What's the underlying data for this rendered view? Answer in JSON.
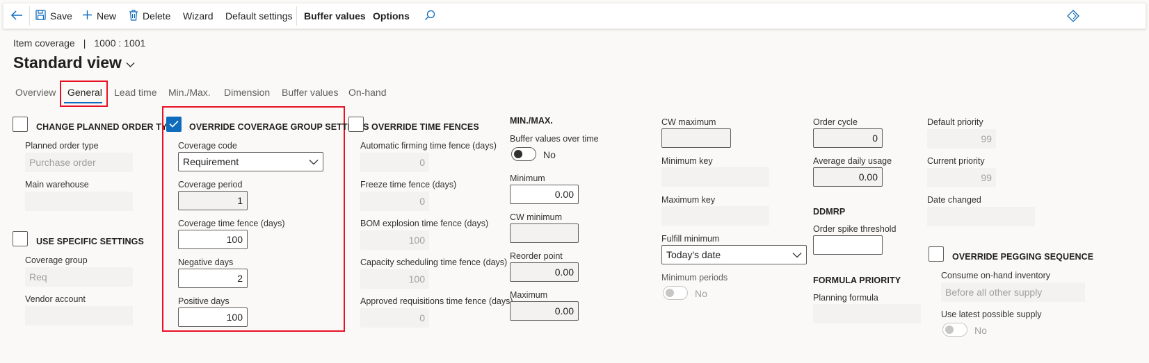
{
  "toolbar": {
    "save": "Save",
    "new": "New",
    "delete": "Delete",
    "wizard": "Wizard",
    "default_settings": "Default settings",
    "buffer_values": "Buffer values",
    "options": "Options",
    "accent": "#0f6cbd"
  },
  "breadcrumb": {
    "page": "Item coverage",
    "separator": "|",
    "record": "1000 : 1001"
  },
  "title": "Standard view",
  "tabs": [
    "Overview",
    "General",
    "Lead time",
    "Min./Max.",
    "Dimension",
    "Buffer values",
    "On-hand"
  ],
  "active_tab": "General",
  "change_planned": {
    "title": "CHANGE PLANNED ORDER TYPE",
    "checked": false,
    "planned_order_type_label": "Planned order type",
    "planned_order_type_value": "Purchase order",
    "main_warehouse_label": "Main warehouse",
    "main_warehouse_value": ""
  },
  "use_specific": {
    "title": "USE SPECIFIC SETTINGS",
    "checked": false,
    "coverage_group_label": "Coverage group",
    "coverage_group_value": "Req",
    "vendor_account_label": "Vendor account",
    "vendor_account_value": ""
  },
  "override_coverage": {
    "title": "OVERRIDE COVERAGE GROUP SETTINGS",
    "checked": true,
    "coverage_code_label": "Coverage code",
    "coverage_code_value": "Requirement",
    "coverage_period_label": "Coverage period",
    "coverage_period_value": "1",
    "coverage_time_fence_label": "Coverage time fence (days)",
    "coverage_time_fence_value": "100",
    "negative_days_label": "Negative days",
    "negative_days_value": "2",
    "positive_days_label": "Positive days",
    "positive_days_value": "100"
  },
  "override_time_fences": {
    "title": "OVERRIDE TIME FENCES",
    "checked": false,
    "auto_firming_label": "Automatic firming time fence (days)",
    "auto_firming_value": "0",
    "freeze_label": "Freeze time fence (days)",
    "freeze_value": "0",
    "bom_label": "BOM explosion time fence (days)",
    "bom_value": "100",
    "capacity_label": "Capacity scheduling time fence (days)",
    "capacity_value": "100",
    "approved_label": "Approved requisitions time fence (days)",
    "approved_value": "0"
  },
  "minmax": {
    "title": "MIN./MAX.",
    "buffer_over_time_label": "Buffer values over time",
    "buffer_over_time_state": "No",
    "minimum_label": "Minimum",
    "minimum_value": "0.00",
    "cw_minimum_label": "CW minimum",
    "cw_minimum_value": "",
    "reorder_label": "Reorder point",
    "reorder_value": "0.00",
    "maximum_label": "Maximum",
    "maximum_value": "0.00"
  },
  "cw": {
    "cw_maximum_label": "CW maximum",
    "cw_maximum_value": "",
    "minimum_key_label": "Minimum key",
    "minimum_key_value": "",
    "maximum_key_label": "Maximum key",
    "maximum_key_value": "",
    "fulfill_minimum_label": "Fulfill minimum",
    "fulfill_minimum_value": "Today's date",
    "minimum_periods_label": "Minimum periods",
    "minimum_periods_state": "No"
  },
  "order": {
    "order_cycle_label": "Order cycle",
    "order_cycle_value": "0",
    "avg_daily_label": "Average daily usage",
    "avg_daily_value": "0.00",
    "ddmrp_title": "DDMRP",
    "spike_label": "Order spike threshold",
    "spike_value": "",
    "formula_title": "FORMULA PRIORITY",
    "planning_formula_label": "Planning formula",
    "planning_formula_value": ""
  },
  "priority": {
    "default_priority_label": "Default priority",
    "default_priority_value": "99",
    "current_priority_label": "Current priority",
    "current_priority_value": "99",
    "date_changed_label": "Date changed",
    "date_changed_value": ""
  },
  "pegging": {
    "title": "OVERRIDE PEGGING SEQUENCE",
    "checked": false,
    "consume_label": "Consume on-hand inventory",
    "consume_value": "Before all other supply",
    "latest_label": "Use latest possible supply",
    "latest_state": "No"
  }
}
